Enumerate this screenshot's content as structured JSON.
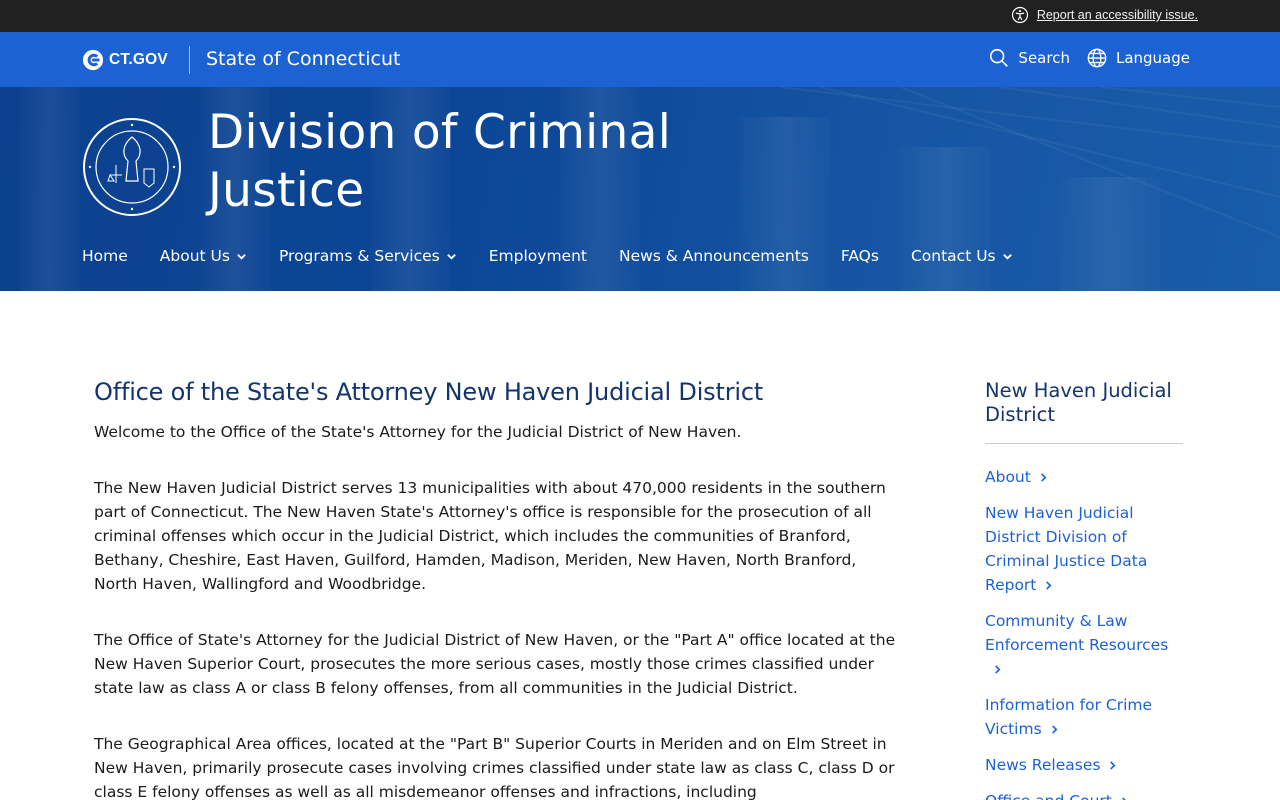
{
  "utility": {
    "accessibility_link": "Report an accessibility issue."
  },
  "ctbar": {
    "logo_text": "CT.GOV",
    "state_name": "State of Connecticut",
    "search_label": "Search",
    "language_label": "Language"
  },
  "hero": {
    "agency_name": "Division of Criminal Justice",
    "seal_icon": "seal-icon"
  },
  "nav": {
    "items": [
      {
        "label": "Home",
        "has_menu": false
      },
      {
        "label": "About Us",
        "has_menu": true
      },
      {
        "label": "Programs & Services",
        "has_menu": true
      },
      {
        "label": "Employment",
        "has_menu": false
      },
      {
        "label": "News & Announcements",
        "has_menu": false
      },
      {
        "label": "FAQs",
        "has_menu": false
      },
      {
        "label": "Contact Us",
        "has_menu": true
      }
    ]
  },
  "main": {
    "title": "Office of the State's Attorney New Haven Judicial District",
    "paragraphs": [
      "Welcome to the Office of the State's Attorney for the Judicial District of New Haven.",
      "The New Haven Judicial District serves 13 municipalities with about 470,000 residents in the southern part of Connecticut. The New Haven State's Attorney's office is responsible for the prosecution of all criminal offenses which occur in the Judicial District, which includes the communities of Branford, Bethany, Cheshire, East Haven, Guilford, Hamden, Madison, Meriden, New Haven, North Branford, North Haven, Wallingford and Woodbridge.",
      "The Office of State's Attorney for the Judicial District of New Haven, or the \"Part A\" office located at the New Haven Superior Court, prosecutes the more serious cases, mostly those crimes classified under state law as class A or class B felony offenses, from all communities in the Judicial District.",
      "The Geographical Area offices, located at the \"Part B\" Superior Courts in Meriden and on Elm Street in New Haven, primarily prosecute cases involving crimes classified under state law as class C, class D or class E felony offenses as well as all misdemeanor offenses and infractions, including"
    ]
  },
  "sidebar": {
    "title": "New Haven Judicial District",
    "items": [
      {
        "label": "About"
      },
      {
        "label": "New Haven Judicial District Division of Criminal Justice Data Report"
      },
      {
        "label": "Community & Law Enforcement Resources"
      },
      {
        "label": "Information for Crime Victims"
      },
      {
        "label": "News Releases"
      },
      {
        "label": "Office and Court"
      }
    ]
  },
  "colors": {
    "utility_bg": "#212121",
    "ctbar_bg": "#1d62d3",
    "hero_bg": "#0d4b9e",
    "title": "#14346c",
    "link": "#1d62d3"
  }
}
